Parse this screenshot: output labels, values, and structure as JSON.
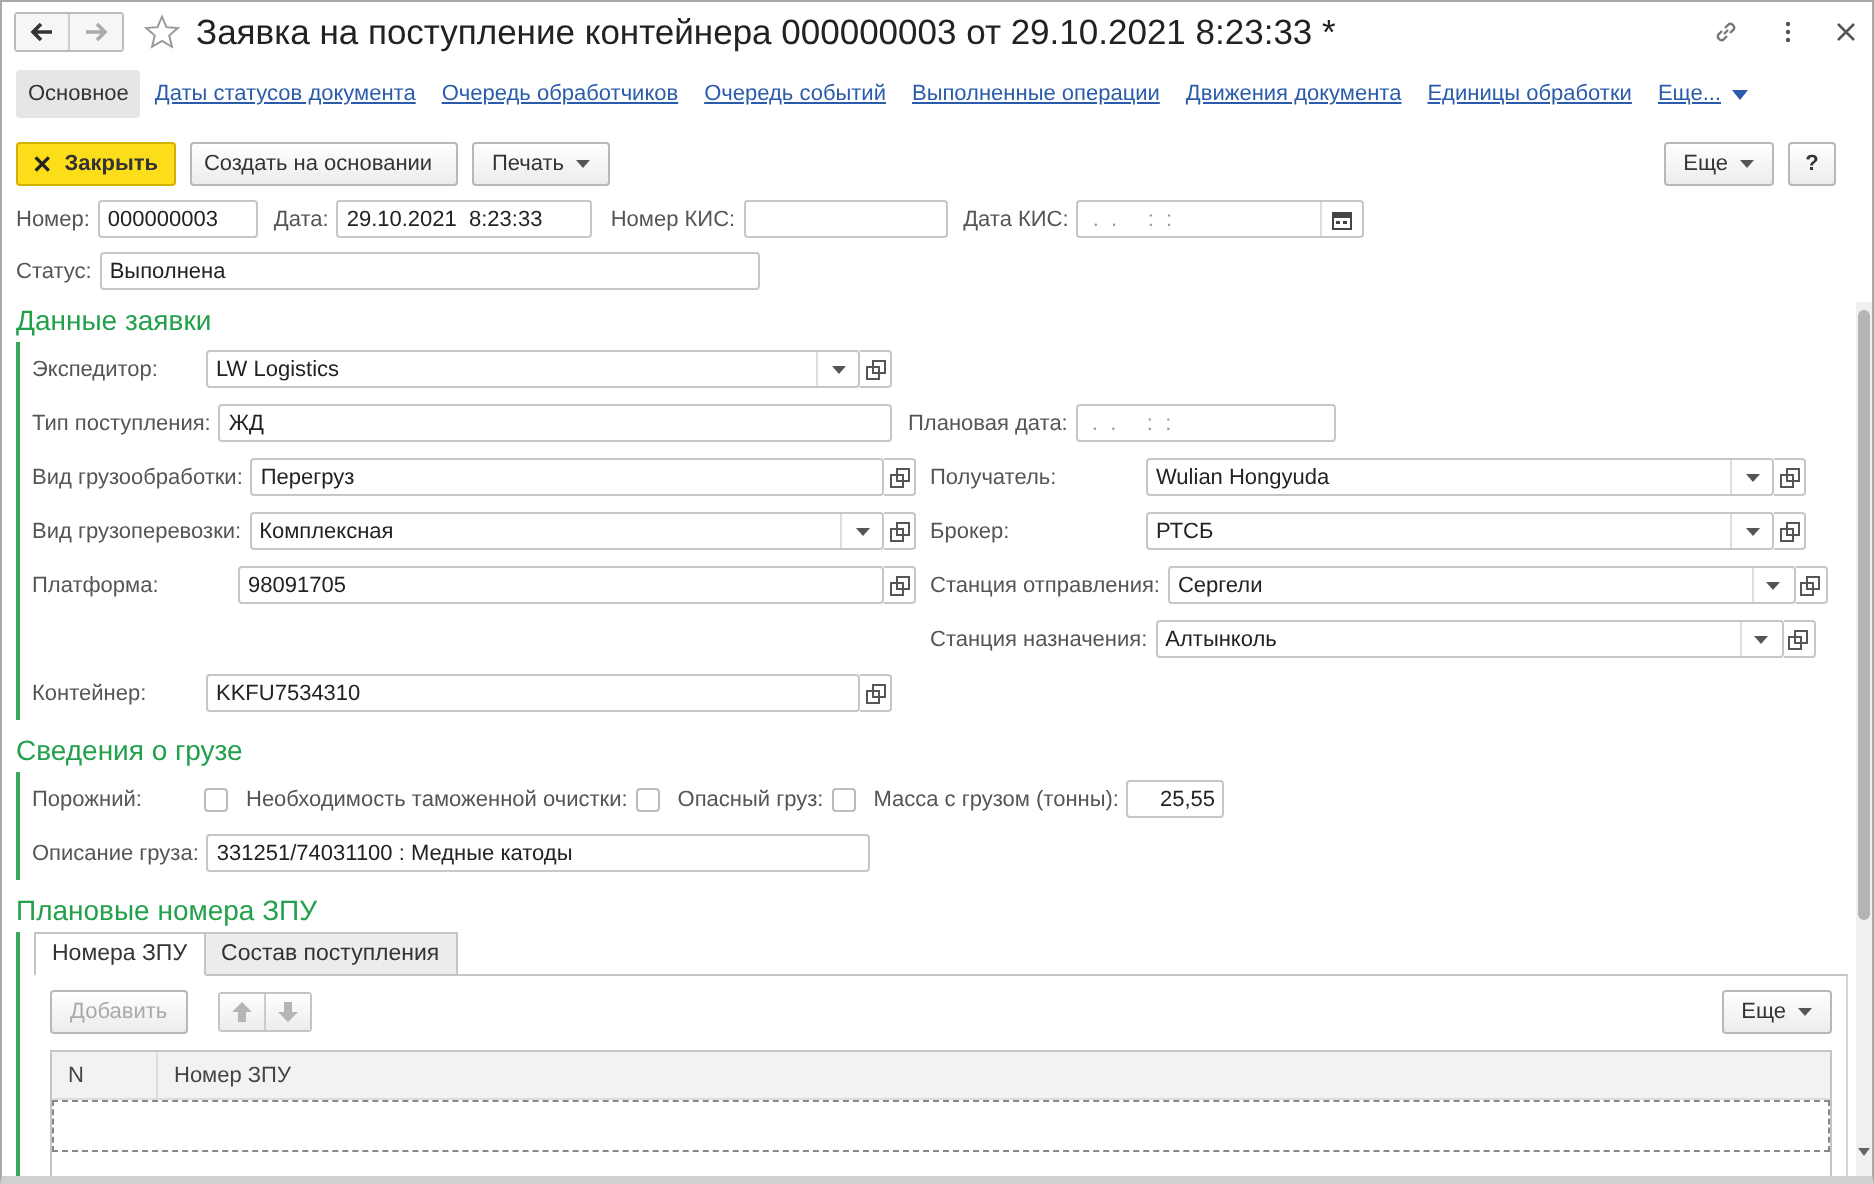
{
  "window": {
    "title": "Заявка на поступление контейнера 000000003 от 29.10.2021 8:23:33 *"
  },
  "tabs": [
    {
      "label": "Основное",
      "selected": true
    },
    {
      "label": "Даты статусов документа",
      "selected": false
    },
    {
      "label": "Очередь обработчиков",
      "selected": false
    },
    {
      "label": "Очередь событий",
      "selected": false
    },
    {
      "label": "Выполненные операции",
      "selected": false
    },
    {
      "label": "Движения документа",
      "selected": false
    },
    {
      "label": "Единицы обработки",
      "selected": false
    }
  ],
  "tabs_more": {
    "label": "Еще..."
  },
  "toolbar": {
    "close": "Закрыть",
    "create": "Создать на основании",
    "print": "Печать",
    "more": "Еще",
    "help": "?"
  },
  "header": [
    {
      "label": "Номер:",
      "value": "000000003",
      "kind": "text"
    },
    {
      "label": "Дата:",
      "value": "29.10.2021  8:23:33",
      "kind": "text"
    },
    {
      "label": "Номер КИС:",
      "kind": "text"
    },
    {
      "label": "Дата КИС:",
      "placeholder": " .  .     :  :",
      "kind": "date"
    }
  ],
  "status": {
    "label": "Статус:",
    "value": "Выполнена",
    "kind": "text"
  },
  "order": {
    "title": "Данные заявки",
    "rows": [
      {
        "left": {
          "label": "Экспедитор:",
          "value": "LW Logistics",
          "kind": "select"
        }
      },
      {
        "left": {
          "label": "Тип поступления:",
          "value": "ЖД",
          "kind": "text"
        },
        "right": {
          "label": "Плановая дата:",
          "placeholder": " .  .     :  :",
          "kind": "text"
        }
      },
      {
        "left": {
          "label": "Вид грузообработки:",
          "value": "Перегруз",
          "kind": "ref"
        },
        "right": {
          "label": "Получатель:",
          "value": "Wulian Hongyuda",
          "kind": "select"
        }
      },
      {
        "left": {
          "label": "Вид грузоперевозки:",
          "value": "Комплексная",
          "kind": "select"
        },
        "right": {
          "label": "Брокер:",
          "value": "РТСБ",
          "kind": "select"
        }
      },
      {
        "left": {
          "label": "Платформа:",
          "value": "98091705",
          "kind": "ref"
        },
        "right": {
          "label": "Станция отправления:",
          "value": "Сергели",
          "kind": "select"
        }
      },
      {
        "right": {
          "label": "Станция назначения:",
          "value": "Алтынколь",
          "kind": "select"
        }
      },
      {
        "left": {
          "label": "Контейнер:",
          "value": "KKFU7534310",
          "kind": "ref"
        }
      }
    ]
  },
  "cargo": {
    "title": "Сведения о грузе",
    "checks": [
      {
        "label": "Порожний:",
        "checked": false
      },
      {
        "label": "Необходимость таможенной очистки:",
        "checked": false
      },
      {
        "label": "Опасный груз:",
        "checked": false
      }
    ],
    "mass": {
      "label": "Масса с грузом (тонны):",
      "value": "25,55",
      "kind": "number"
    },
    "description": {
      "label": "Описание груза:",
      "value": "331251/74031100 : Медные катоды",
      "kind": "text"
    }
  },
  "seals": {
    "title": "Плановые номера ЗПУ",
    "tabs": [
      {
        "label": "Номера ЗПУ",
        "selected": true
      },
      {
        "label": "Состав поступления",
        "selected": false
      }
    ],
    "add_button": {
      "label": "Добавить",
      "disabled": true
    },
    "move_buttons": {
      "disabled": true
    },
    "more_button": "Еще",
    "columns": [
      "N",
      "Номер ЗПУ"
    ]
  }
}
